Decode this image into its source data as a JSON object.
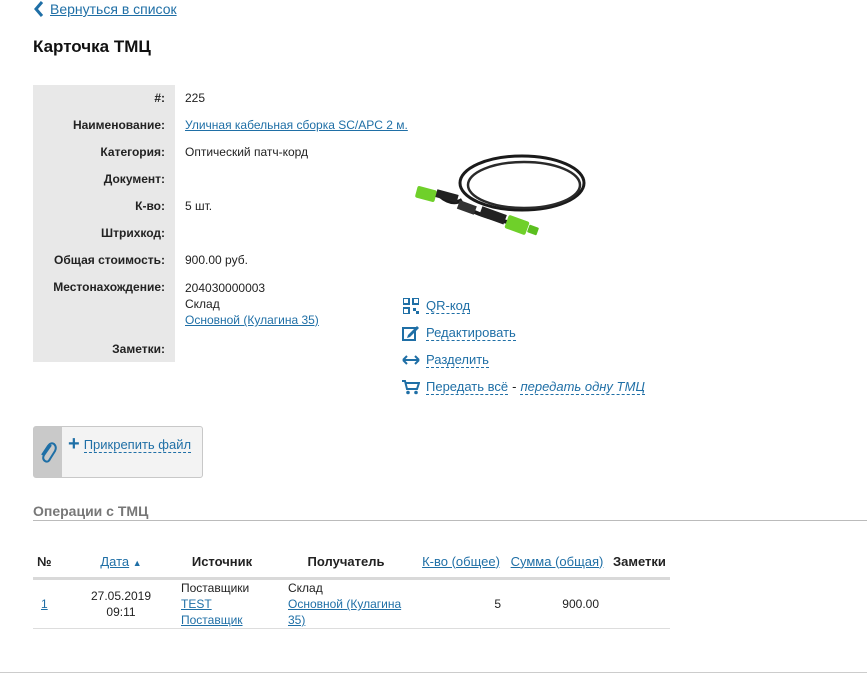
{
  "back_link": "Вернуться в список",
  "page_title": "Карточка ТМЦ",
  "card": {
    "labels": {
      "number": "#:",
      "name": "Наименование:",
      "category": "Категория:",
      "document": "Документ:",
      "quantity": "К-во:",
      "barcode": "Штрихкод:",
      "total_cost": "Общая стоимость:",
      "location": "Местонахождение:",
      "notes": "Заметки:"
    },
    "values": {
      "number": "225",
      "name": "Уличная кабельная сборка SC/APC 2 м.",
      "category": "Оптический патч-корд",
      "document": "",
      "quantity": "5 шт.",
      "barcode": "",
      "total_cost": "900.00 руб.",
      "location_code": "204030000003",
      "location_type": "Склад",
      "location_name": "Основной (Кулагина 35)",
      "notes": ""
    }
  },
  "actions": {
    "qr": "QR-код",
    "edit": "Редактировать",
    "split": "Разделить",
    "transfer_all": "Передать всё",
    "separator": "-",
    "transfer_one": "передать одну ТМЦ"
  },
  "attach_button": "Прикрепить файл",
  "operations": {
    "title": "Операции с ТМЦ",
    "headers": {
      "num": "№",
      "date": "Дата",
      "source": "Источник",
      "receiver": "Получатель",
      "qty": "К-во (общее)",
      "sum": "Сумма (общая)",
      "notes": "Заметки"
    },
    "rows": [
      {
        "num": "1",
        "date": "27.05.2019 09:11",
        "source_type": "Поставщики",
        "source_name": "TEST Поставщик",
        "receiver_type": "Склад",
        "receiver_name": "Основной (Кулагина 35)",
        "qty": "5",
        "sum": "900.00",
        "notes": ""
      }
    ]
  },
  "colors": {
    "link": "#1f6fa6",
    "label_bg": "#e8e8e8",
    "connector_green": "#6fd02a"
  }
}
